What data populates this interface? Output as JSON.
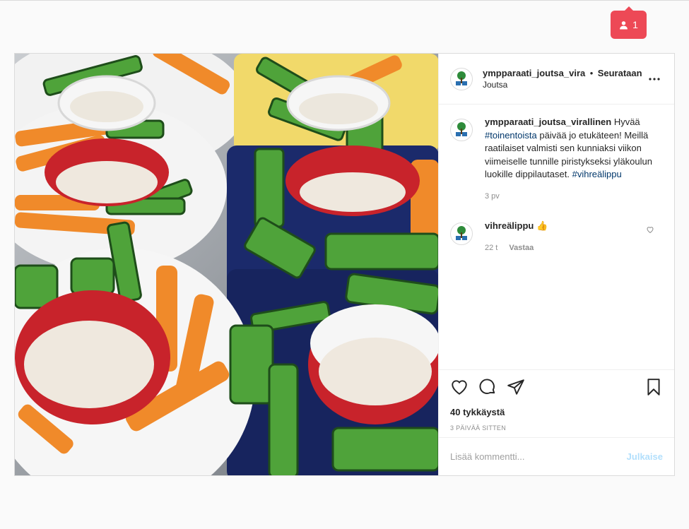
{
  "notification": {
    "count": "1",
    "icon": "person-icon",
    "color": "#ed4956"
  },
  "post": {
    "image_description_icon": "photo",
    "account": {
      "username": "ympparaati_joutsa_vira",
      "separator": "•",
      "follow_state": "Seurataan",
      "location": "Joutsa"
    },
    "caption": {
      "username": "ympparaati_joutsa_virallinen",
      "text_part1": "Hyvää",
      "hashtag1": "#toinentoista",
      "text_part2": "päivää jo etukäteen! Meillä raatilaiset valmisti sen kunniaksi viikon viimeiselle tunnille piristykseksi yläkoulun luokille dippilautaset.",
      "hashtag2": "#vihreälippu",
      "time": "3 pv"
    },
    "comment": {
      "username": "vihreälippu",
      "emoji": "👍",
      "time": "22 t",
      "reply_label": "Vastaa"
    },
    "likes": "40 tykkäystä",
    "date": "3 PÄIVÄÄ SITTEN",
    "add_comment_placeholder": "Lisää kommentti...",
    "publish_label": "Julkaise"
  },
  "colors": {
    "link": "#00376b",
    "publish_disabled": "#b2dffc"
  }
}
